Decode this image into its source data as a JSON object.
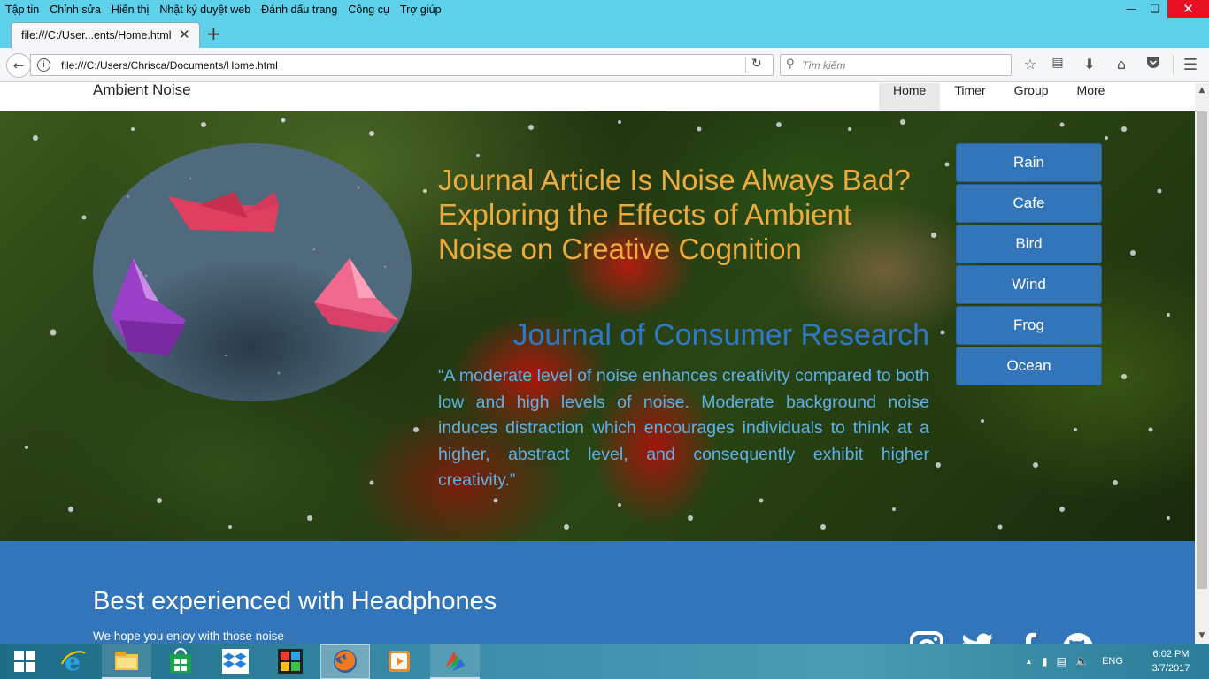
{
  "browser": {
    "menu": [
      "Tập tin",
      "Chỉnh sửa",
      "Hiển thị",
      "Nhật ký duyệt web",
      "Đánh dấu trang",
      "Công cụ",
      "Trợ giúp"
    ],
    "tab_title": "file:///C:/User...ents/Home.html",
    "url": "file:///C:/Users/Chrisca/Documents/Home.html",
    "search_placeholder": "Tìm kiếm",
    "toolbar_icons": [
      "star-icon",
      "reading-list-icon",
      "download-icon",
      "home-icon",
      "pocket-icon",
      "hamburger-menu-icon"
    ]
  },
  "site": {
    "brand": "Ambient Noise",
    "nav": [
      "Home",
      "Timer",
      "Group",
      "More"
    ],
    "active_nav": "Home",
    "hero": {
      "title": "Journal Article Is Noise Always Bad? Exploring the Effects of Ambient Noise on Creative Cognition",
      "journal": "Journal of Consumer Research",
      "quote": "“A moderate level of noise enhances creativity compared to both low and high levels of noise. Moderate background noise induces distraction which encourages individuals to think at a higher, abstract level, and consequently exhibit higher creativity.”"
    },
    "sounds": [
      "Rain",
      "Cafe",
      "Bird",
      "Wind",
      "Frog",
      "Ocean"
    ],
    "footer": {
      "title": "Best experienced with Headphones",
      "subtitle": "We hope you enjoy with those noise",
      "social_icons": [
        "instagram-icon",
        "twitter-icon",
        "facebook-icon",
        "github-icon"
      ]
    },
    "colors": {
      "title": "#eeab3d",
      "journal": "#2f78c4",
      "quote": "#5fb1e6",
      "button": "#3375b9",
      "footer": "#3375b9"
    }
  },
  "taskbar": {
    "apps": [
      "start-icon",
      "internet-explorer-icon",
      "file-explorer-icon",
      "store-icon",
      "dropbox-icon",
      "puzzle-app-icon",
      "firefox-icon",
      "media-player-icon",
      "app-icon"
    ],
    "language": "ENG",
    "time": "6:02 PM",
    "date": "3/7/2017"
  }
}
